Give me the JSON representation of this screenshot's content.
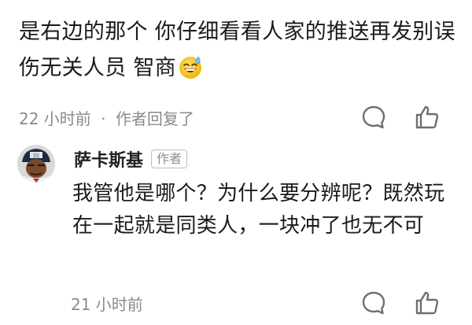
{
  "top_comment": {
    "text": "是右边的那个 你仔细看看人家的推送再发别误伤无关人员 智商",
    "emoji": "sweat-smile-emoji",
    "meta": {
      "time": "22 小时前",
      "separator": "·",
      "reply_status": "作者回复了"
    }
  },
  "reply": {
    "name": "萨卡斯基",
    "badge": "作者",
    "text": "我管他是哪个？为什么要分辨呢？既然玩在一起就是同类人，一块冲了也无不可",
    "time": "21 小时前"
  },
  "icons": {
    "comment": "comment-bubble-icon",
    "like": "thumbs-up-icon"
  },
  "colors": {
    "text_primary": "#1b1b1b",
    "text_meta": "#8a8a8a",
    "icon": "#6f6f6f"
  }
}
